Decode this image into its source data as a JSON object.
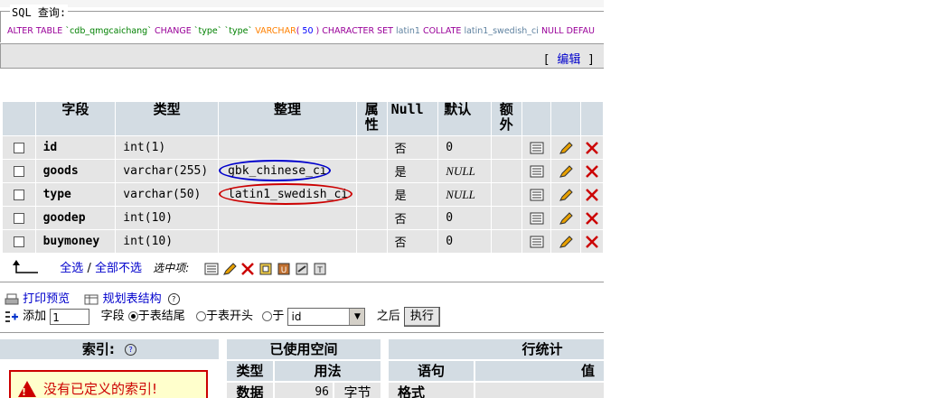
{
  "sql": {
    "legend": "SQL 查询:",
    "tokens": [
      {
        "text": "ALTER TABLE ",
        "cls": "k"
      },
      {
        "text": "`cdb_qmgcaichang`",
        "cls": "s"
      },
      {
        "text": " CHANGE ",
        "cls": "k"
      },
      {
        "text": "`type`",
        "cls": "s"
      },
      {
        "text": " ",
        "cls": ""
      },
      {
        "text": "`type`",
        "cls": "s"
      },
      {
        "text": " VARCHAR",
        "cls": "t"
      },
      {
        "text": "( ",
        "cls": "k"
      },
      {
        "text": "50",
        "cls": "n"
      },
      {
        "text": " ) ",
        "cls": "k"
      },
      {
        "text": "CHARACTER SET ",
        "cls": "k"
      },
      {
        "text": "latin1 ",
        "cls": "c"
      },
      {
        "text": "COLLATE ",
        "cls": "k"
      },
      {
        "text": "latin1_swedish_ci ",
        "cls": "c"
      },
      {
        "text": "NULL ",
        "cls": "k"
      },
      {
        "text": "DEFAU",
        "cls": "k"
      }
    ],
    "edit_label": "编辑"
  },
  "table": {
    "headers": [
      "字段",
      "类型",
      "整理",
      "属性",
      "Null",
      "默认",
      "额外"
    ],
    "header_attr": "属\n性",
    "header_extra": "额\n外",
    "rows": [
      {
        "field": "id",
        "type": "int(1)",
        "collation": "",
        "attr": "",
        "null": "否",
        "default": "0",
        "default_italic": false,
        "extra": ""
      },
      {
        "field": "goods",
        "type": "varchar(255)",
        "collation": "gbk_chinese_ci",
        "attr": "",
        "null": "是",
        "default": "NULL",
        "default_italic": true,
        "extra": "",
        "highlight": "#0000cc"
      },
      {
        "field": "type",
        "type": "varchar(50)",
        "collation": "latin1_swedish_ci",
        "attr": "",
        "null": "是",
        "default": "NULL",
        "default_italic": true,
        "extra": "",
        "highlight": "#cc0000"
      },
      {
        "field": "goodep",
        "type": "int(10)",
        "collation": "",
        "attr": "",
        "null": "否",
        "default": "0",
        "default_italic": false,
        "extra": ""
      },
      {
        "field": "buymoney",
        "type": "int(10)",
        "collation": "",
        "attr": "",
        "null": "否",
        "default": "0",
        "default_italic": false,
        "extra": ""
      }
    ]
  },
  "selection": {
    "select_all": "全选",
    "separator": "/",
    "deselect_all": "全部不选",
    "with_selected": "选中项:"
  },
  "actions": {
    "print_preview": "打印预览",
    "plan_structure": "规划表结构",
    "add_label": "添加",
    "add_count": "1",
    "field_label": "字段",
    "at_end": "于表结尾",
    "at_start": "于表开头",
    "after_label": "于",
    "after_field": "id",
    "after_suffix": "之后",
    "execute": "执行"
  },
  "indexes": {
    "title": "索引:",
    "warning": "没有已定义的索引!"
  },
  "space": {
    "title": "已使用空间",
    "col_type": "类型",
    "col_usage": "用法",
    "row_label": "数据",
    "row_value": "96",
    "row_unit": "字节"
  },
  "rowstats": {
    "title": "行统计",
    "col_statement": "语句",
    "col_value": "值",
    "row_label": "格式"
  }
}
